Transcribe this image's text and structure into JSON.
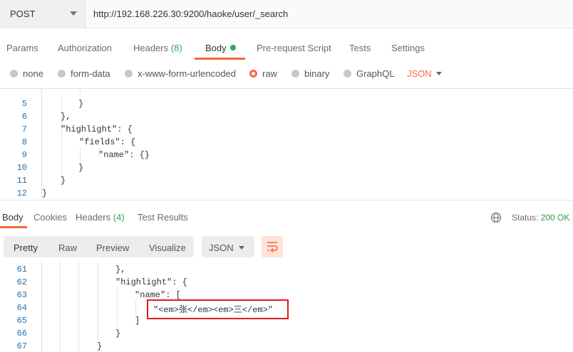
{
  "request": {
    "method": "POST",
    "url": "http://192.168.226.30:9200/haoke/user/_search",
    "tabs": [
      {
        "label": "Params"
      },
      {
        "label": "Authorization"
      },
      {
        "label": "Headers",
        "count": "(8)"
      },
      {
        "label": "Body"
      },
      {
        "label": "Pre-request Script"
      },
      {
        "label": "Tests"
      },
      {
        "label": "Settings"
      }
    ],
    "active_tab": "Body",
    "body_types": [
      "none",
      "form-data",
      "x-www-form-urlencoded",
      "raw",
      "binary",
      "GraphQL"
    ],
    "selected_body_type": "raw",
    "language": "JSON",
    "editor": {
      "line_numbers": [
        "5",
        "6",
        "7",
        "8",
        "9",
        "10",
        "11",
        "12"
      ],
      "lines": [
        "}",
        "},",
        "\"highlight\": {",
        "\"fields\": {",
        "\"name\": {}",
        "}",
        "}",
        "}"
      ]
    }
  },
  "response": {
    "tabs": [
      {
        "label": "Body"
      },
      {
        "label": "Cookies"
      },
      {
        "label": "Headers",
        "count": "(4)"
      },
      {
        "label": "Test Results"
      }
    ],
    "active_tab": "Body",
    "status_label": "Status:",
    "status_value": "200 OK",
    "view_modes": [
      "Pretty",
      "Raw",
      "Preview",
      "Visualize"
    ],
    "active_view": "Pretty",
    "format": "JSON",
    "editor": {
      "line_numbers": [
        "61",
        "62",
        "63",
        "64",
        "65",
        "66",
        "67"
      ],
      "lines": [
        "},",
        "\"highlight\": {",
        "\"name\": [",
        "\"<em>张</em><em>三</em>\"",
        "]",
        "}",
        "}"
      ]
    }
  },
  "colors": {
    "accent": "#f26b3a",
    "status_ok": "#2b9a4a",
    "count": "#3fa15a",
    "line_number": "#2d6fa6",
    "highlight_box": "#e11b1b"
  }
}
